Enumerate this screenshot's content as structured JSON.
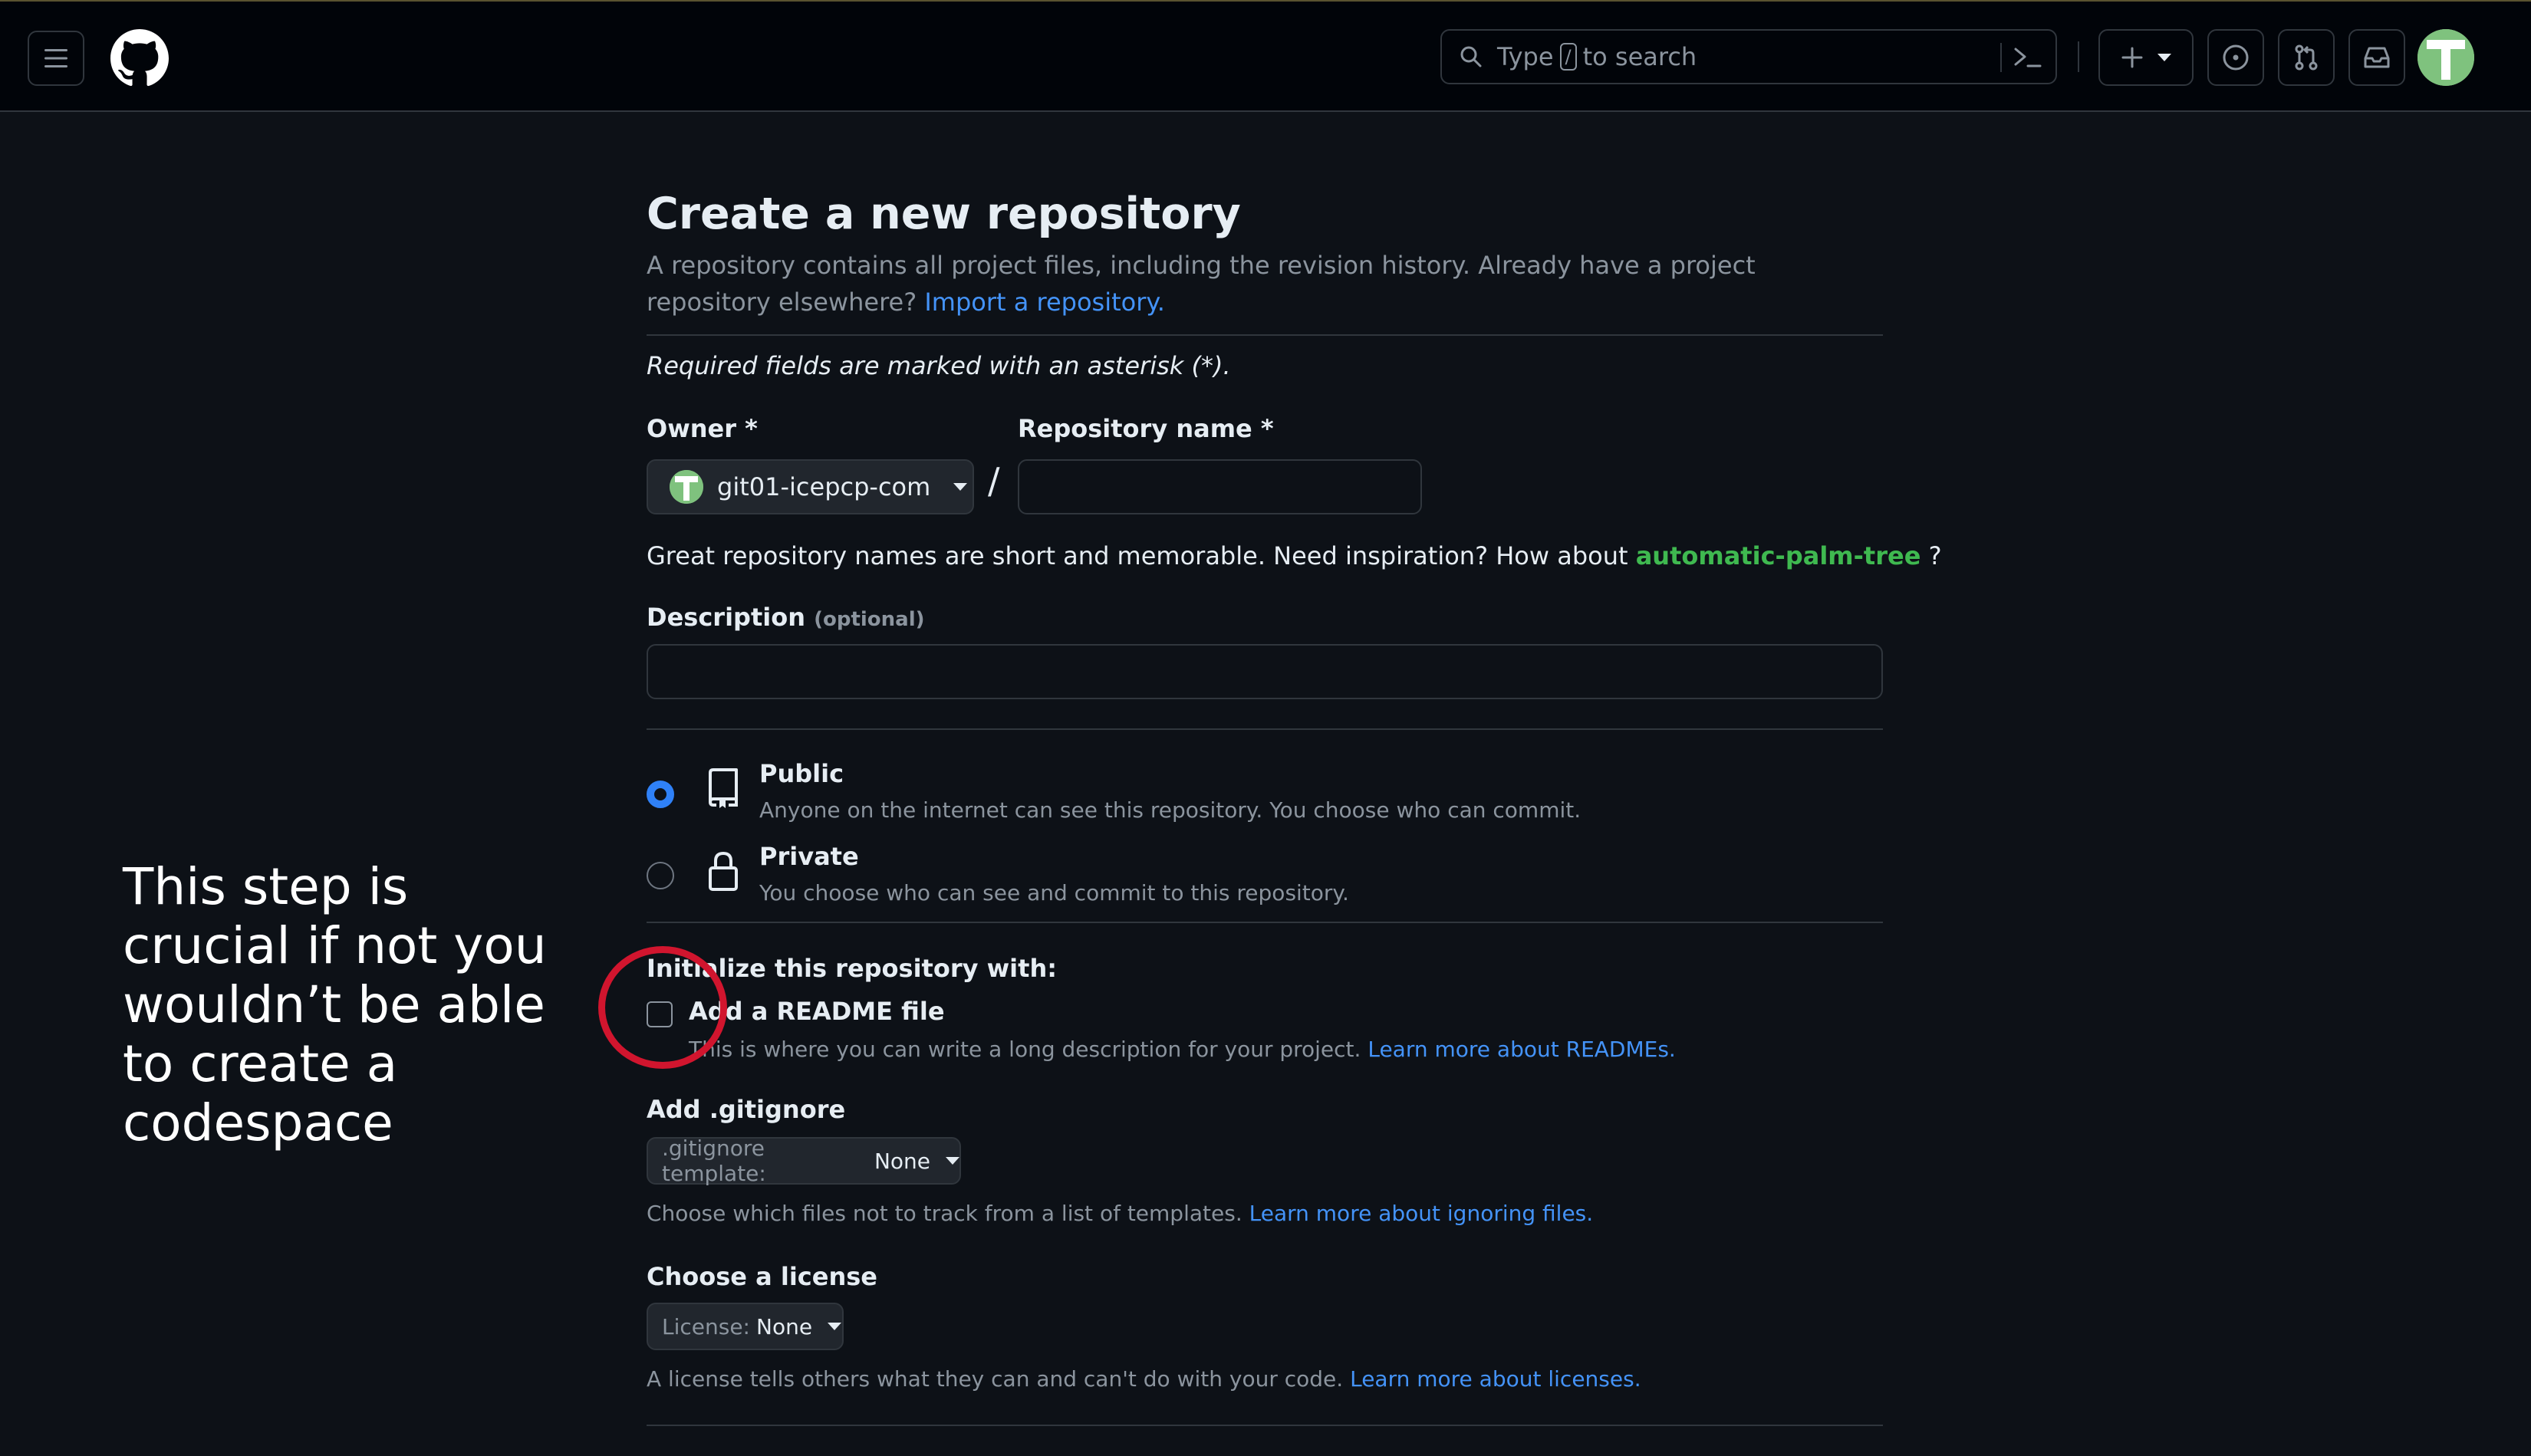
{
  "header": {
    "search_prefix": "Type",
    "search_key": "/",
    "search_suffix": "to search"
  },
  "page": {
    "title": "Create a new repository",
    "subtitle": "A repository contains all project files, including the revision history. Already have a project repository elsewhere?",
    "import_link": "Import a repository.",
    "required_note": "Required fields are marked with an asterisk (*)."
  },
  "owner": {
    "label": "Owner *",
    "value": "git01-icepcp-com"
  },
  "repo_name": {
    "label": "Repository name *",
    "value": "",
    "separator": "/"
  },
  "inspiration": {
    "text": "Great repository names are short and memorable. Need inspiration? How about",
    "suggestion": "automatic-palm-tree",
    "end": "?"
  },
  "description": {
    "label": "Description",
    "optional": "(optional)",
    "value": ""
  },
  "visibility": {
    "selected": "public",
    "public_title": "Public",
    "public_desc": "Anyone on the internet can see this repository. You choose who can commit.",
    "private_title": "Private",
    "private_desc": "You choose who can see and commit to this repository."
  },
  "init": {
    "heading": "Initialize this repository with:",
    "readme_label": "Add a README file",
    "readme_checked": false,
    "readme_desc": "This is where you can write a long description for your project.",
    "readme_link": "Learn more about READMEs."
  },
  "gitignore": {
    "label": "Add .gitignore",
    "select_prefix": ".gitignore template:",
    "select_value": "None",
    "desc": "Choose which files not to track from a list of templates.",
    "link": "Learn more about ignoring files."
  },
  "license": {
    "label": "Choose a license",
    "select_prefix": "License:",
    "select_value": "None",
    "desc": "A license tells others what they can and can't do with your code.",
    "link": "Learn more about licenses."
  },
  "annotation": {
    "text": "This step is crucial if not you wouldn’t be able to create a codespace"
  },
  "colors": {
    "background": "#0d1117",
    "header": "#010409",
    "accent_blue": "#2f81f7",
    "link": "#4493f8",
    "suggestion_green": "#3fb950",
    "annotation_ring": "#d1152e"
  }
}
